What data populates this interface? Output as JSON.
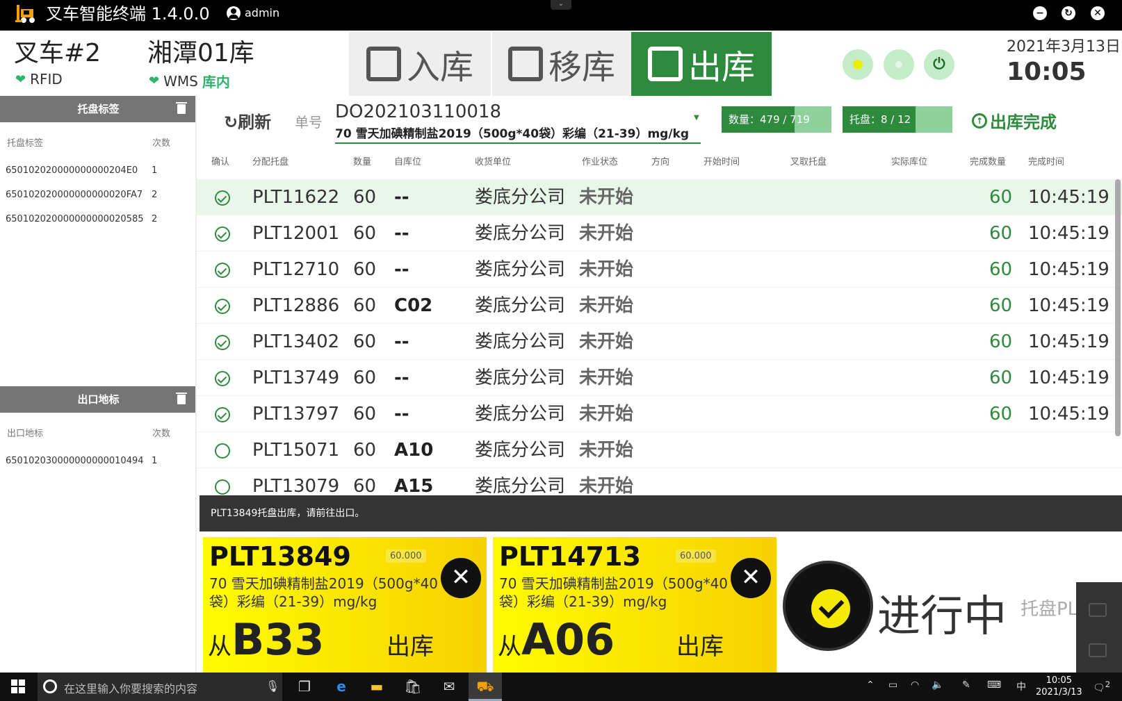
{
  "app": {
    "title": "叉车智能终端 1.4.0.0",
    "user": "admin",
    "menu_caret": "⌄"
  },
  "window_controls": {
    "minimize": "−",
    "restore": "↻",
    "close": "✕"
  },
  "header": {
    "vehicle": "叉车#2",
    "rfid_label": "RFID",
    "warehouse": "湘潭01库",
    "wms_label": "WMS",
    "wms_state": "库内",
    "modes": [
      {
        "name": "inbound",
        "label": "入库",
        "active": false
      },
      {
        "name": "move",
        "label": "移库",
        "active": false
      },
      {
        "name": "outbound",
        "label": "出库",
        "active": true
      }
    ],
    "date": "2021年3月13日",
    "time": "10:05"
  },
  "pallet_tags": {
    "title": "托盘标签",
    "col_tag": "托盘标签",
    "col_count": "次数",
    "rows": [
      {
        "tag": "650102020000000000204E0",
        "count": "1"
      },
      {
        "tag": "650102020000000000020FA7",
        "count": "2"
      },
      {
        "tag": "650102020000000000020585",
        "count": "2"
      }
    ]
  },
  "exit_markers": {
    "title": "出口地标",
    "col_tag": "出口地标",
    "col_count": "次数",
    "rows": [
      {
        "tag": "650102030000000000010494",
        "count": "1"
      }
    ]
  },
  "toolbar": {
    "refresh": "刷新",
    "order_label": "单号",
    "order_no": "DO202103110018",
    "order_desc": "70 雪天加碘精制盐2019（500g*40袋）彩编（21-39）mg/kg",
    "qty_text": "数量：479 / 719",
    "qty_progress": 0.666,
    "pallet_text": "托盘：8 / 12",
    "pallet_progress": 0.667,
    "complete": "出库完成"
  },
  "table": {
    "headers": [
      "确认",
      "分配托盘",
      "数量",
      "自库位",
      "收货单位",
      "作业状态",
      "方向",
      "开始时间",
      "叉取托盘",
      "实际库位",
      "完成数量",
      "完成时间"
    ],
    "rows": [
      {
        "done": true,
        "pallet": "PLT11622",
        "qty": "60",
        "loc": "--",
        "receiver": "娄底分公司",
        "state": "未开始",
        "done_qty": "60",
        "done_time": "10:45:19"
      },
      {
        "done": true,
        "pallet": "PLT12001",
        "qty": "60",
        "loc": "--",
        "receiver": "娄底分公司",
        "state": "未开始",
        "done_qty": "60",
        "done_time": "10:45:19"
      },
      {
        "done": true,
        "pallet": "PLT12710",
        "qty": "60",
        "loc": "--",
        "receiver": "娄底分公司",
        "state": "未开始",
        "done_qty": "60",
        "done_time": "10:45:19"
      },
      {
        "done": true,
        "pallet": "PLT12886",
        "qty": "60",
        "loc": "C02",
        "receiver": "娄底分公司",
        "state": "未开始",
        "done_qty": "60",
        "done_time": "10:45:19"
      },
      {
        "done": true,
        "pallet": "PLT13402",
        "qty": "60",
        "loc": "--",
        "receiver": "娄底分公司",
        "state": "未开始",
        "done_qty": "60",
        "done_time": "10:45:19"
      },
      {
        "done": true,
        "pallet": "PLT13749",
        "qty": "60",
        "loc": "--",
        "receiver": "娄底分公司",
        "state": "未开始",
        "done_qty": "60",
        "done_time": "10:45:19"
      },
      {
        "done": true,
        "pallet": "PLT13797",
        "qty": "60",
        "loc": "--",
        "receiver": "娄底分公司",
        "state": "未开始",
        "done_qty": "60",
        "done_time": "10:45:19"
      },
      {
        "done": false,
        "pallet": "PLT15071",
        "qty": "60",
        "loc": "A10",
        "receiver": "娄底分公司",
        "state": "未开始",
        "done_qty": "",
        "done_time": ""
      },
      {
        "done": false,
        "pallet": "PLT13079",
        "qty": "60",
        "loc": "A15",
        "receiver": "娄底分公司",
        "state": "未开始",
        "done_qty": "",
        "done_time": ""
      }
    ]
  },
  "message": "PLT13849托盘出库，请前往出口。",
  "cards": [
    {
      "id": "PLT13849",
      "badge": "60.000",
      "desc": "70 雪天加碘精制盐2019（500g*40袋）彩编（21-39）mg/kg",
      "from_prefix": "从",
      "from_loc": "B33",
      "action": "出库"
    },
    {
      "id": "PLT14713",
      "badge": "60.000",
      "desc": "70 雪天加碘精制盐2019（500g*40袋）彩编（21-39）mg/kg",
      "from_prefix": "从",
      "from_loc": "A06",
      "action": "出库"
    }
  ],
  "progress": {
    "status": "进行中",
    "hint": "托盘PL"
  },
  "colors": {
    "accent": "#2e8b3e",
    "card_yellow": "#fffb00",
    "title_bar": "#000000"
  },
  "taskbar": {
    "search_placeholder": "在这里输入你要搜索的内容",
    "ime": "中",
    "clock_time": "10:05",
    "clock_date": "2021/3/13",
    "notifications": "2"
  }
}
